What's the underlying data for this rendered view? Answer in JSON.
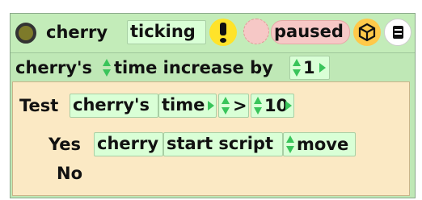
{
  "header": {
    "player_name": "cherry",
    "status_label": "ticking",
    "paused_label": "paused"
  },
  "increase_line": {
    "owner": "cherry's",
    "action": "time increase by",
    "amount": "1"
  },
  "test": {
    "label": "Test",
    "owner": "cherry's",
    "slot": "time",
    "operator": ">",
    "compare_value": "10"
  },
  "yes": {
    "label": "Yes",
    "player": "cherry",
    "command": "start script",
    "script_name": "move"
  },
  "no": {
    "label": "No"
  },
  "colors": {
    "tile_green": "#d9ffd6",
    "header_green": "#c3ecb9",
    "test_tan": "#fbe9c4",
    "arrow_green": "#39c45a",
    "alert_yellow": "#ffe32a",
    "pause_pink": "#f6c8c6"
  },
  "icons": [
    "circle-menu-icon",
    "exclamation-icon",
    "clock-icon",
    "cube-icon",
    "menu-icon",
    "up-down-arrow-icon",
    "right-arrow-icon"
  ]
}
